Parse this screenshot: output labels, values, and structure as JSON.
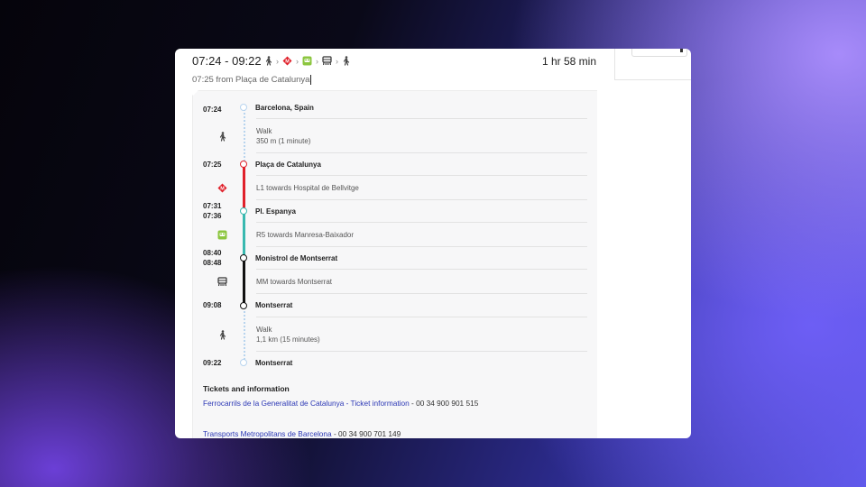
{
  "colors": {
    "l1_red": "#e0212b",
    "r5_teal": "#39b9b0",
    "rack_black": "#111111",
    "walk_blue": "#b8d4ee",
    "fgc_green": "#8cc63f",
    "link_blue": "#2b37b5"
  },
  "trip": {
    "time_range": "07:24 - 09:22",
    "route_icons": [
      "walk-icon",
      "metro-icon",
      "train-icon",
      "rack-railway-icon",
      "walk-icon"
    ],
    "duration": "1 hr 58 min",
    "departure_note": "07:25 from Plaça de Catalunya"
  },
  "timeline": {
    "stops": [
      {
        "times": [
          "07:24"
        ],
        "name": "Barcelona, Spain"
      },
      {
        "times": [
          "07:25"
        ],
        "name": "Plaça de Catalunya"
      },
      {
        "times": [
          "07:31",
          "07:36"
        ],
        "name": "Pl. Espanya"
      },
      {
        "times": [
          "08:40",
          "08:48"
        ],
        "name": "Monistrol de Montserrat"
      },
      {
        "times": [
          "09:08"
        ],
        "name": "Montserrat"
      },
      {
        "times": [
          "09:22"
        ],
        "name": "Montserrat"
      }
    ],
    "legs": [
      {
        "icon": "walk-icon",
        "line1": "Walk",
        "line2": "350 m (1 minute)"
      },
      {
        "icon": "metro-icon",
        "line1": "L1 towards Hospital de Bellvitge",
        "line2": ""
      },
      {
        "icon": "train-icon",
        "line1": "R5 towards Manresa-Baixador",
        "line2": ""
      },
      {
        "icon": "rack-railway-icon",
        "line1": "MM towards Montserrat",
        "line2": ""
      },
      {
        "icon": "walk-icon",
        "line1": "Walk",
        "line2": "1,1 km (15 minutes)"
      }
    ]
  },
  "tickets": {
    "title": "Tickets and information",
    "items": [
      {
        "link": "Ferrocarrils de la Generalitat de Catalunya - Ticket information",
        "suffix": " - 00 34 900 901 515"
      },
      {
        "link": "Transports Metropolitans de Barcelona",
        "suffix": " - 00 34 900 701 149"
      }
    ]
  }
}
